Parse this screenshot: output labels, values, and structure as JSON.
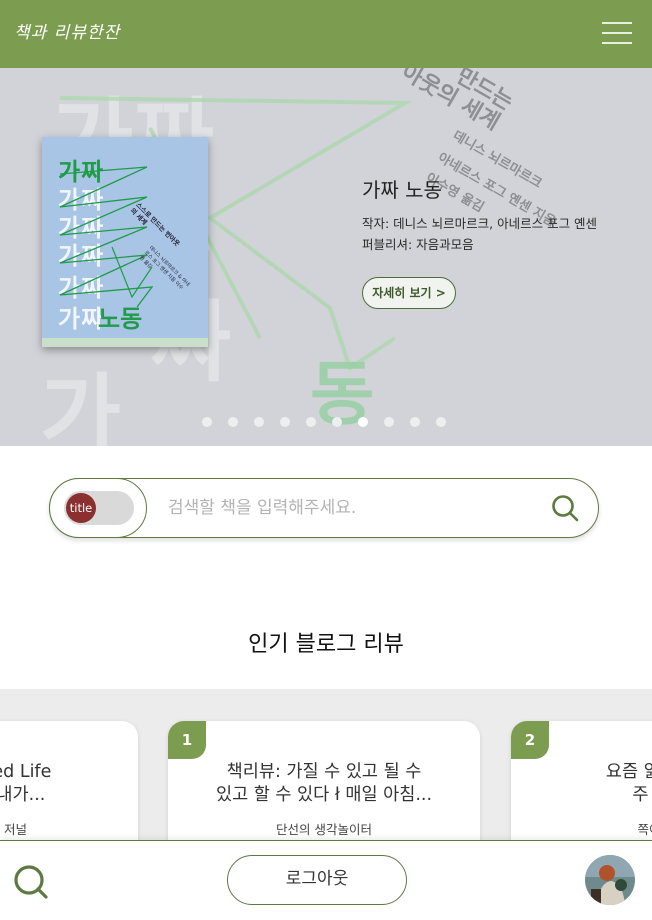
{
  "header": {
    "logo_text": "책과 리뷰한잔",
    "menu_icon": "hamburger-icon"
  },
  "hero": {
    "cover": {
      "title_top": "가짜",
      "words": [
        "가짜",
        "가짜",
        "가짜",
        "가짜",
        "가짜"
      ],
      "title_bottom": "노동",
      "subtitle": "스스로 만드는 번아웃의 세계",
      "small_text": "데니스 뇌르마르크 & 아네르스 포그 옌센 지음 이수영 옮김"
    },
    "background_text": {
      "line1": "만드는",
      "line2": "아웃의 세계",
      "line3": "데니스 뇌르마르크",
      "line4": "아네르스 포그 옌센 지음",
      "line5": "이수영 옮김"
    },
    "book_title": "가짜 노동",
    "author": "작자: 데니스 뇌르마르크, 아네르스 포그 옌센",
    "publisher": "퍼블리셔: 자음과모음",
    "more_button": "자세히 보기 >",
    "slide_count": 10,
    "active_slide": 6
  },
  "search": {
    "toggle_label": "title",
    "placeholder": "검색할 책을 입력해주세요.",
    "value": ""
  },
  "popular": {
    "title": "인기 블로그 리뷰",
    "cards": [
      {
        "rank": "",
        "title": "Earned Life\n로운 내가...",
        "author": "밴딩 저널"
      },
      {
        "rank": "1",
        "title": "책리뷰: 가질 수 있고 될 수\n있고 할 수 있다 ł 매일 아침...",
        "author": "단선의 생각놀이터"
      },
      {
        "rank": "2",
        "title": "요즘 읽을만한\n주 | 쪽",
        "author": "쪽이"
      }
    ]
  },
  "bottom": {
    "logout_label": "로그아웃",
    "search_icon": "search-icon",
    "avatar_icon": "avatar"
  },
  "colors": {
    "brand": "#7c9d50",
    "brand_dark": "#5d7a43",
    "toggle_knob": "#8c2f2f",
    "hero_bg": "#d1d3d8"
  }
}
